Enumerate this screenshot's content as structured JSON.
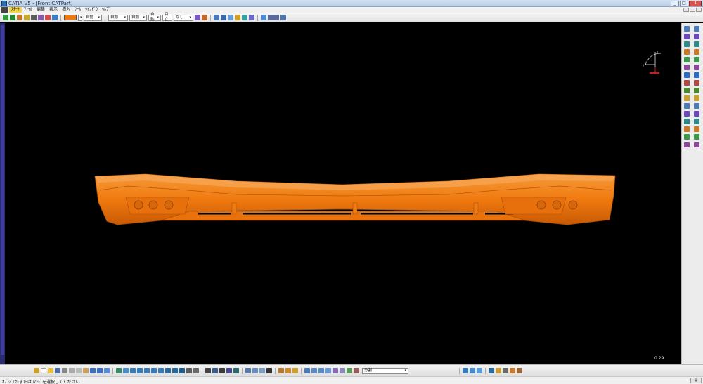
{
  "window": {
    "title": "CATIA V5 - [Front.CATPart]",
    "buttons": [
      "_",
      "□",
      "X"
    ]
  },
  "menu": {
    "items": [
      "ｽﾀｰﾄ",
      "ﾌｧｲﾙ",
      "編集",
      "表示",
      "挿入",
      "ﾂｰﾙ",
      "ｳｨﾝﾄﾞｳ",
      "ﾍﾙﾌﾟ"
    ],
    "active_index": 0
  },
  "toolbar": {
    "color_swatch": "#f07a0f",
    "dropdowns": [
      "自動",
      "自動",
      "自動",
      "自動",
      "目立",
      "なし"
    ]
  },
  "bottom_toolbar": {
    "layer_dropdown": "分割"
  },
  "viewport": {
    "background": "#000000",
    "part_color": "#f07a0f",
    "scale_readout": "0.29"
  },
  "status": {
    "message": "ｵﾌﾞｼﾞｪｸﾄまたはｺﾏﾝﾄﾞを選択してください"
  },
  "icons": {
    "top": [
      "pan-icon",
      "move-icon",
      "rotate-icon",
      "fill-icon",
      "spline-icon",
      "scissors-icon",
      "paint-icon",
      "select-icon"
    ],
    "right_col_1": [
      "sketch-icon",
      "plane-icon",
      "line-icon",
      "point-icon",
      "curve-icon",
      "surface-icon",
      "sweep-icon",
      "offset-icon",
      "join-icon",
      "trim-icon",
      "fillet-icon",
      "extract-icon",
      "blend-icon",
      "translate-icon",
      "analysis-icon",
      "measure-icon"
    ],
    "right_col_2": [
      "pad-icon",
      "pocket-icon",
      "hole-icon",
      "shaft-icon",
      "rib-icon",
      "loft-icon",
      "shell-icon",
      "draft-icon",
      "chamfer-icon",
      "split-icon",
      "thicken-icon",
      "close-surface-icon",
      "pattern-icon",
      "mirror-icon",
      "boolean-icon",
      "publish-icon"
    ]
  }
}
